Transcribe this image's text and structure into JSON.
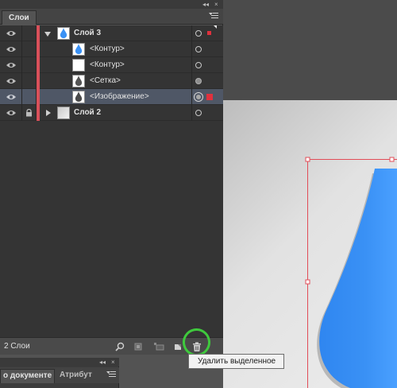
{
  "panel": {
    "tab_label": "Слои",
    "status": "2 Слои"
  },
  "layers": [
    {
      "name": "Слой 3",
      "type": "layer"
    },
    {
      "name": "<Контур>",
      "type": "path"
    },
    {
      "name": "<Контур>",
      "type": "path"
    },
    {
      "name": "<Сетка>",
      "type": "mesh"
    },
    {
      "name": "<Изображение>",
      "type": "image"
    },
    {
      "name": "Слой 2",
      "type": "layer"
    }
  ],
  "tooltip": "Удалить выделенное",
  "bottom_panel": {
    "tabs": [
      "о документе",
      "Атрибут"
    ]
  },
  "colors": {
    "layer_color": "#d9505a",
    "selection": "#e0313d",
    "drop_blue": "#3a91f5",
    "highlight_circle": "#3fc93d"
  },
  "icons": [
    "eye-icon",
    "lock-icon",
    "search-icon",
    "make-clipping-mask-icon",
    "new-sublayer-icon",
    "new-layer-icon",
    "trash-icon",
    "panel-menu-icon",
    "collapse-icon"
  ]
}
